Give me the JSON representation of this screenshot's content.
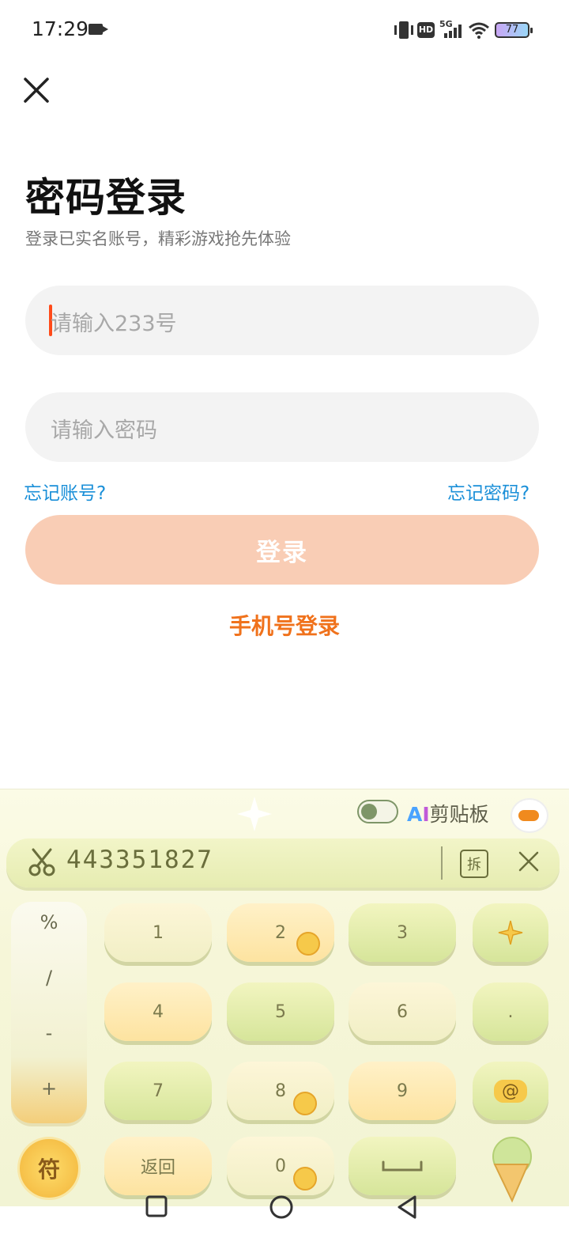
{
  "status_bar": {
    "time": "17:29",
    "icons": [
      "video-record-icon",
      "vibrate-icon",
      "hd-icon",
      "5g-signal-icon",
      "wifi-icon",
      "battery-icon"
    ],
    "hd_label": "HD",
    "network_label": "5G",
    "battery": "77"
  },
  "header": {
    "close_icon": "close-icon",
    "title": "密码登录",
    "subtitle": "登录已实名账号，精彩游戏抢先体验"
  },
  "form": {
    "account_placeholder": "请输入233号",
    "password_placeholder": "请输入密码",
    "forgot_account": "忘记账号?",
    "forgot_password": "忘记密码?",
    "login_button": "登录",
    "phone_login": "手机号登录"
  },
  "keyboard": {
    "toggle_state": "off",
    "ai_prefix": "A",
    "ai_prefix2": "I",
    "clipboard_label": "剪贴板",
    "candidate": "443351827",
    "split_label": "拆",
    "symbols": [
      "%",
      "/",
      "-",
      "+"
    ],
    "rows": [
      [
        "1",
        "2",
        "3"
      ],
      [
        "4",
        "5",
        "6",
        "."
      ],
      [
        "7",
        "8",
        "9",
        "@"
      ],
      [
        "返回",
        "0",
        "space"
      ]
    ],
    "fu_key": "符",
    "space_icon": "space-icon",
    "emoji_icon": "sparkle-icon",
    "mascot_icon": "tiger-mascot-icon"
  },
  "nav_bar": {
    "icons": [
      "recent-apps-icon",
      "home-icon",
      "back-icon"
    ]
  },
  "colors": {
    "accent_orange": "#f0721c",
    "login_button_disabled": "#f9cdb5",
    "link_blue": "#1a8fd8",
    "caret_red": "#ff4b1a"
  }
}
